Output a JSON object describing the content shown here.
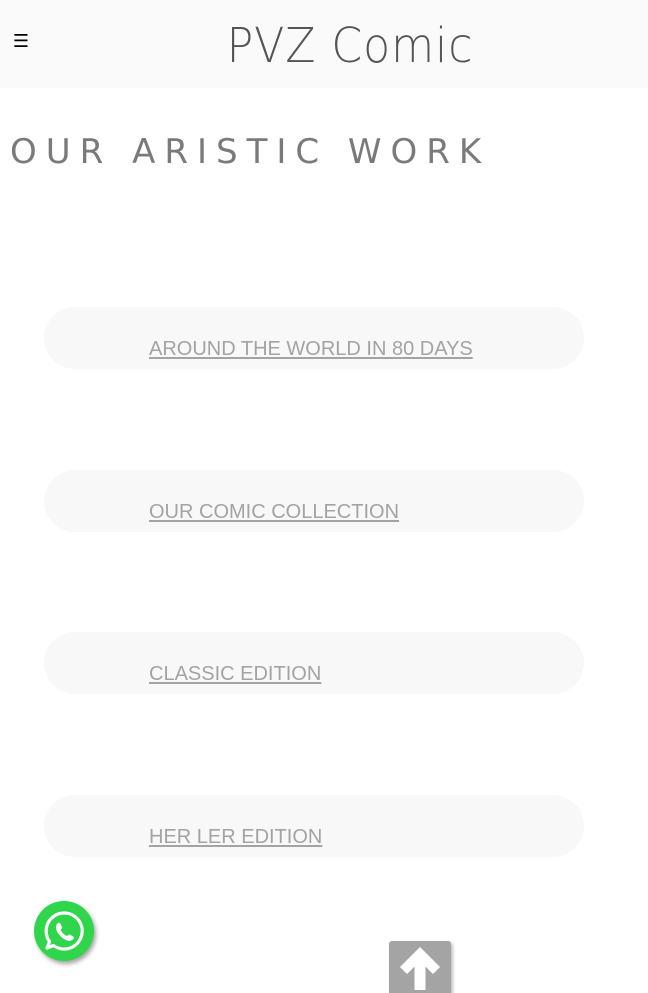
{
  "header": {
    "menu_icon": "hamburger-icon",
    "menu_glyph": "☰",
    "site_title": "PVZ Comic"
  },
  "main": {
    "section_heading": "OUR ARISTIC WORK",
    "works": [
      {
        "label": "AROUND THE WORLD IN 80 DAYS"
      },
      {
        "label": "OUR COMIC COLLECTION"
      },
      {
        "label": "CLASSIC EDITION"
      },
      {
        "label": "HER LER EDITION"
      }
    ]
  },
  "floating": {
    "whatsapp_icon": "whatsapp-icon",
    "scroll_top_icon": "arrow-up-icon"
  },
  "colors": {
    "header_bg": "#fafafa",
    "card_bg": "#f8f8f8",
    "link_text": "#a3a3a3",
    "heading_text": "#7a7a7a",
    "whatsapp_green": "#2fd64b",
    "scroll_top_bg": "#a4a4a4"
  }
}
